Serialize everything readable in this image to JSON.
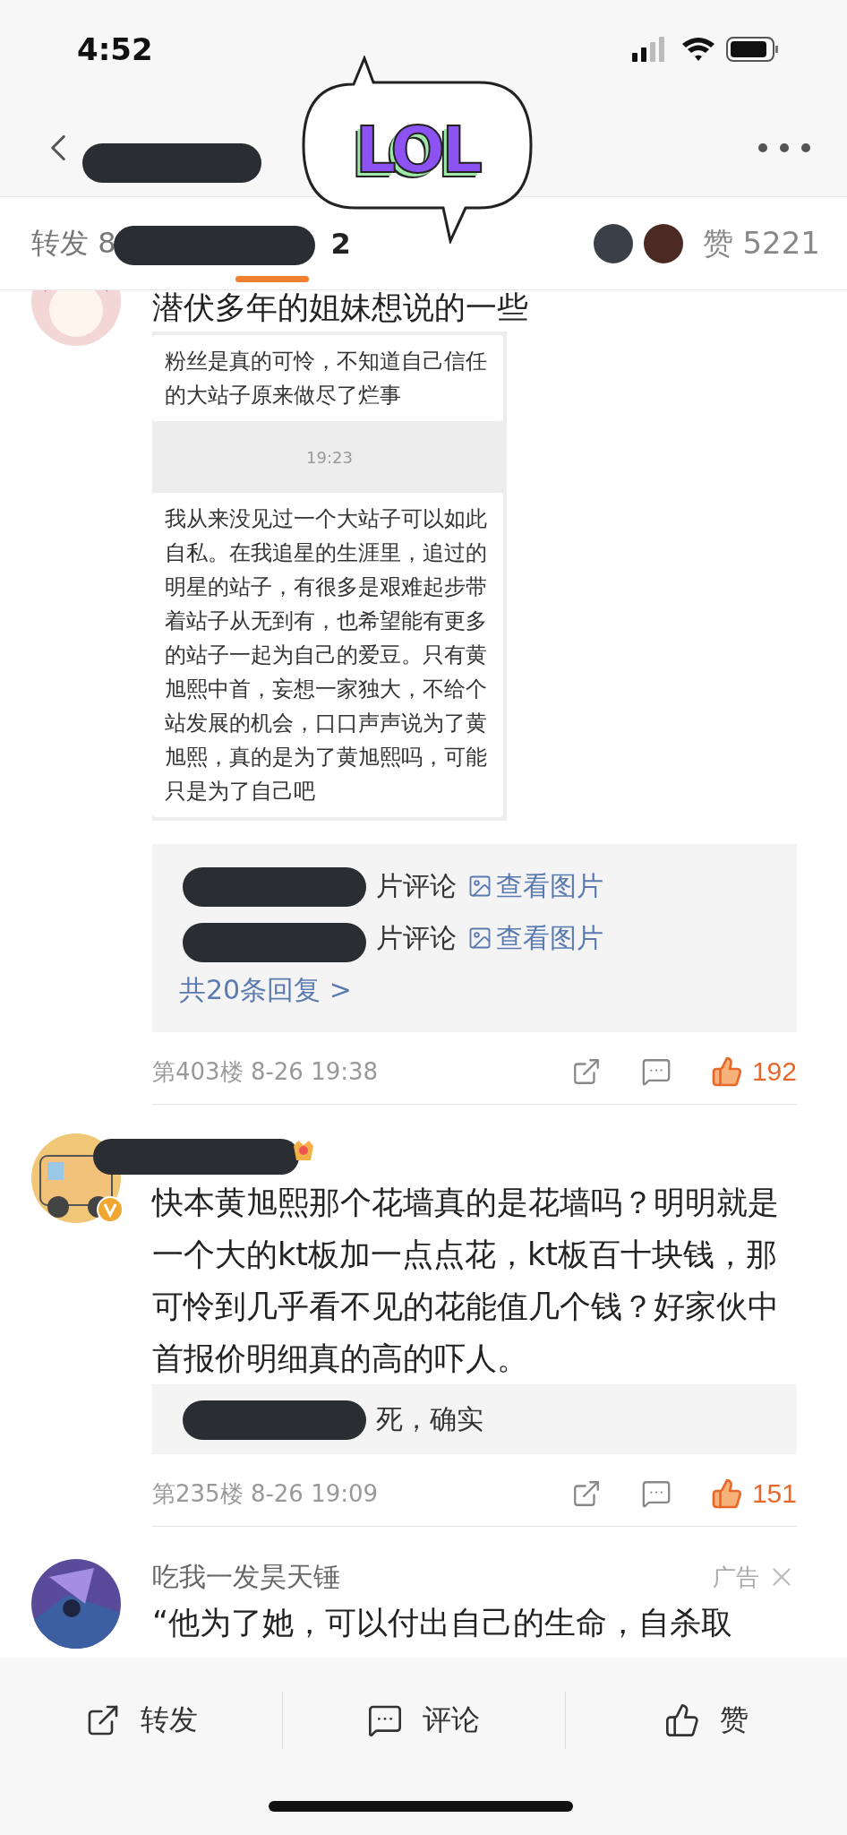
{
  "status_bar": {
    "time": "4:52"
  },
  "sticker": {
    "text": "LOL"
  },
  "tab_bar": {
    "repost_prefix": "转发 8",
    "repost_suffix": "2",
    "likes_label": "赞",
    "likes_count": "5221"
  },
  "comments": [
    {
      "kind": "post",
      "text": "潜伏多年的姐妹想说的一些",
      "quote": {
        "messages": [
          "粉丝是真的可怜，不知道自己信任的大站子原来做尽了烂事",
          "我从来没见过一个大站子可以如此自私。在我追星的生涯里，追过的明星的站子，有很多是艰难起步带着站子从无到有，也希望能有更多的站子一起为自己的爱豆。只有黄旭熙中首，妄想一家独大，不给个站发展的机会，口口声声说为了黄旭熙，真的是为了黄旭熙吗，可能只是为了自己吧"
        ],
        "time": "19:23"
      },
      "replies": [
        {
          "text": "片评论",
          "link": "查看图片"
        },
        {
          "text": "片评论",
          "link": "查看图片"
        }
      ],
      "more_replies": "共20条回复 >",
      "floor": "第403楼 8-26 19:38",
      "likes": "192",
      "liked": true
    },
    {
      "kind": "post",
      "verified": true,
      "text": "快本黄旭熙那个花墙真的是花墙吗？明明就是一个大的kt板加一点点花，kt板百十块钱，那可怜到几乎看不见的花能值几个钱？好家伙中首报价明细真的高的吓人。",
      "replies": [
        {
          "text": "死，确实"
        }
      ],
      "floor": "第235楼 8-26 19:09",
      "likes": "151",
      "liked": true
    }
  ],
  "ad": {
    "name": "吃我一发昊天锤",
    "badge": "广告",
    "text": "“他为了她，可以付出自己的生命，自杀取"
  },
  "bottom_bar": [
    {
      "kind": "repost",
      "label": "转发"
    },
    {
      "kind": "comment",
      "label": "评论"
    },
    {
      "kind": "like",
      "label": "赞"
    }
  ]
}
